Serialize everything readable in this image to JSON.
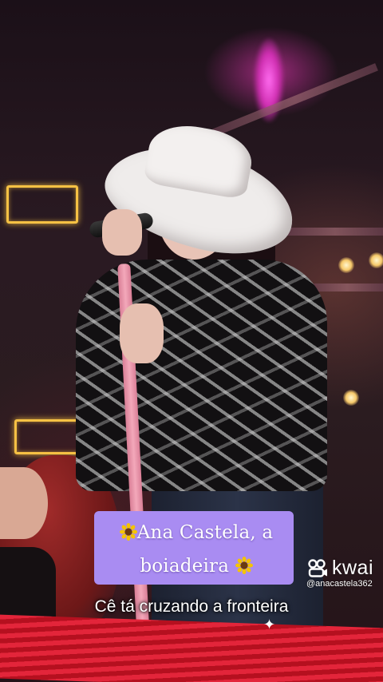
{
  "caption": {
    "line1": "Ana Castela, a",
    "line2": "boiadeira",
    "emoji_icon": "sunflower-icon",
    "background_color": "#a98cf2"
  },
  "subtitle": "Cê tá cruzando a fronteira",
  "watermark": {
    "brand": "kwai",
    "handle": "@anacastela362",
    "logo_icon": "kwai-logo-icon"
  }
}
